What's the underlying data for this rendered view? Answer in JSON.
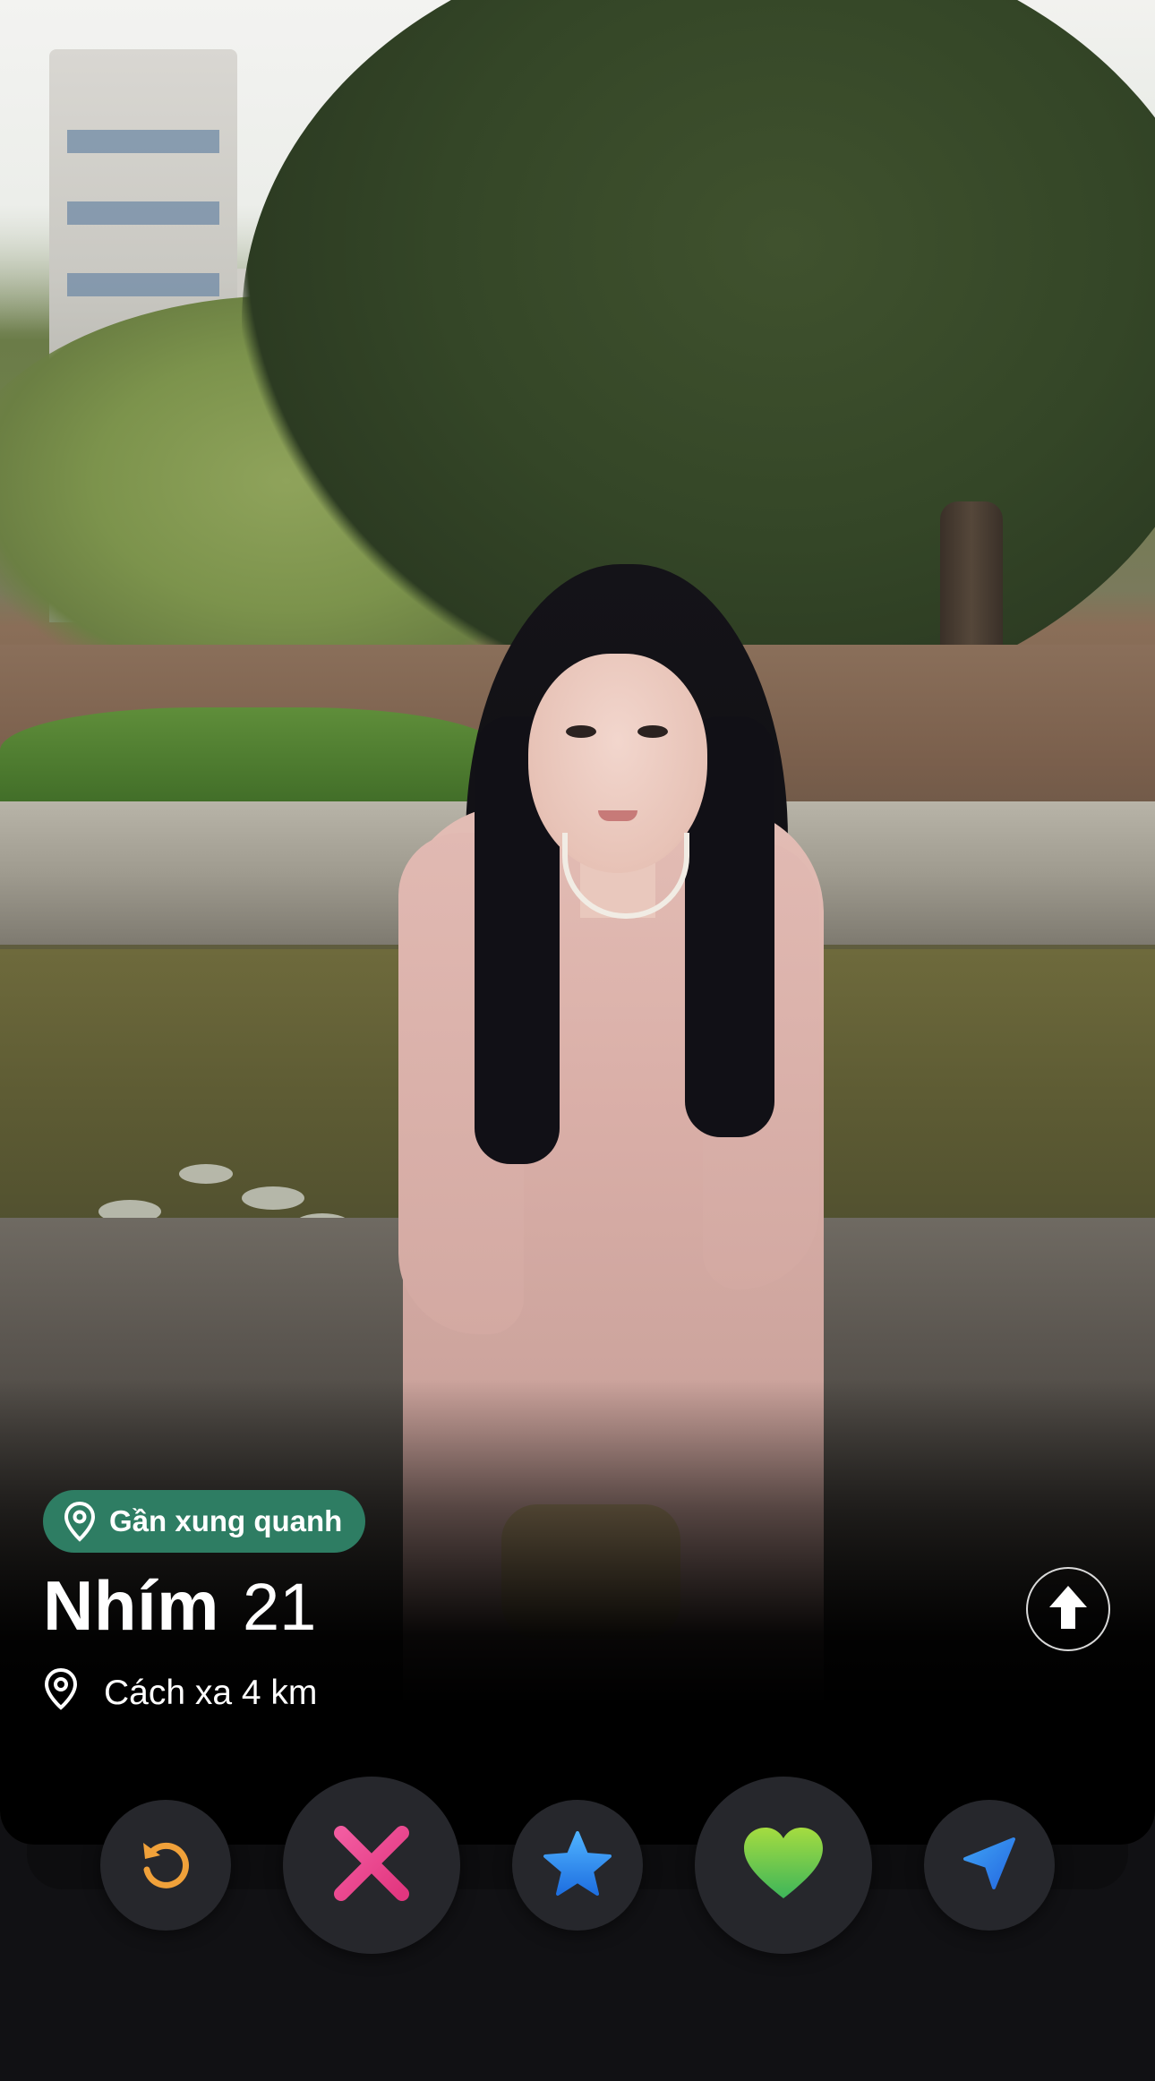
{
  "profile": {
    "badge_label": "Gần xung quanh",
    "name": "Nhím",
    "age": "21",
    "distance": "Cách xa 4 km"
  },
  "actions": [
    {
      "name": "rewind",
      "icon": "rewind-icon",
      "color": "#F0A13A"
    },
    {
      "name": "nope",
      "icon": "close-icon",
      "color": "#E8408F"
    },
    {
      "name": "super-like",
      "icon": "star-icon",
      "color": "#2E8BF0"
    },
    {
      "name": "like",
      "icon": "heart-icon",
      "color": "#7CCB3A"
    },
    {
      "name": "boost",
      "icon": "send-icon",
      "color": "#2F7BEA"
    }
  ],
  "colors": {
    "badge_bg": "#2E7D63",
    "background": "#111114"
  }
}
